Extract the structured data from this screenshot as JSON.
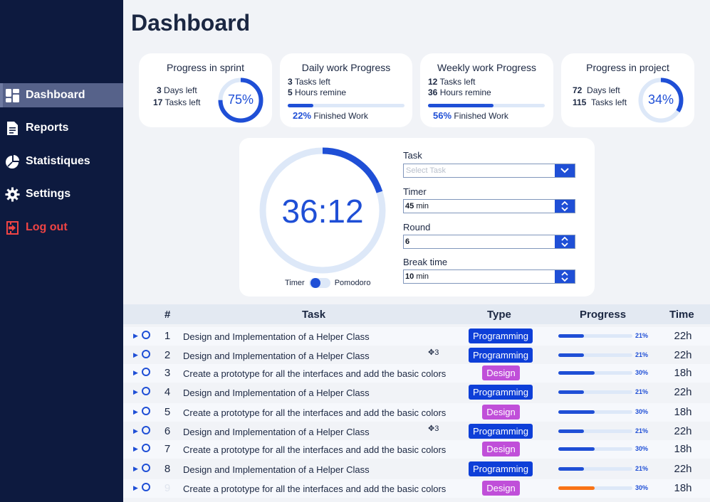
{
  "sidebar": {
    "items": [
      {
        "label": "Dashboard",
        "icon": "dashboard-icon",
        "active": true
      },
      {
        "label": "Reports",
        "icon": "document-icon"
      },
      {
        "label": "Statistiques",
        "icon": "pie-chart-icon"
      },
      {
        "label": "Settings",
        "icon": "gear-icon"
      },
      {
        "label": "Log out",
        "icon": "logout-icon",
        "color": "#ef4444"
      }
    ]
  },
  "page_title": "Dashboard",
  "cards": {
    "sprint": {
      "title": "Progress in sprint",
      "days": "3",
      "days_label": "Days left",
      "tasks": "17",
      "tasks_label": "Tasks left",
      "percent_label": "75%",
      "percent": 75
    },
    "daily": {
      "title": "Daily work Progress",
      "tasks": "3",
      "tasks_label": "Tasks left",
      "hours": "5",
      "hours_label": "Hours remine",
      "percent_label": "22%",
      "percent": 22,
      "finished_label": "Finished Work"
    },
    "weekly": {
      "title": "Weekly work Progress",
      "tasks": "12",
      "tasks_label": "Tasks left",
      "hours": "36",
      "hours_label": "Hours remine",
      "percent_label": "56%",
      "percent": 56,
      "finished_label": "Finished Work"
    },
    "project": {
      "title": "Progress in project",
      "days": "72",
      "days_label": "Days left",
      "tasks": "115",
      "tasks_label": "Tasks left",
      "percent_label": "34%",
      "percent": 34
    }
  },
  "timer": {
    "display": "36:12",
    "progress_fraction": 0.2,
    "toggle_left": "Timer",
    "toggle_right": "Pomodoro",
    "task_label": "Task",
    "task_placeholder": "Select Task",
    "timer_label": "Timer",
    "timer_value": "45",
    "timer_unit": "min",
    "round_label": "Round",
    "round_value": "6",
    "break_label": "Break time",
    "break_value": "10",
    "break_unit": "min"
  },
  "colors": {
    "accent": "#1f4fd6",
    "programming": "#0e3fd8",
    "design": "#c04fd9",
    "warning": "#f97316",
    "sidebar": "#0d1a3f"
  },
  "table": {
    "headers": {
      "num": "#",
      "task": "Task",
      "type": "Type",
      "progress": "Progress",
      "time": "Time"
    },
    "rows": [
      {
        "num": "1",
        "task": "Design and Implementation of a Helper Class",
        "type": "Programming",
        "percent": 21,
        "percent_label": "21%",
        "time": "22h"
      },
      {
        "num": "2",
        "task": "Design and Implementation of a Helper Class",
        "extra": "✥3",
        "type": "Programming",
        "percent": 21,
        "percent_label": "21%",
        "time": "22h"
      },
      {
        "num": "3",
        "task": "Create a prototype for all the interfaces and add the basic colors",
        "type": "Design",
        "percent": 30,
        "percent_label": "30%",
        "time": "18h"
      },
      {
        "num": "4",
        "task": "Design and Implementation of a Helper Class",
        "type": "Programming",
        "percent": 21,
        "percent_label": "21%",
        "time": "22h"
      },
      {
        "num": "5",
        "task": "Create a prototype for all the interfaces and add the basic colors",
        "type": "Design",
        "percent": 30,
        "percent_label": "30%",
        "time": "18h"
      },
      {
        "num": "6",
        "task": "Design and Implementation of a Helper Class",
        "extra": "✥3",
        "type": "Programming",
        "percent": 21,
        "percent_label": "21%",
        "time": "22h"
      },
      {
        "num": "7",
        "task": "Create a prototype for all the interfaces and add the basic colors",
        "type": "Design",
        "percent": 30,
        "percent_label": "30%",
        "time": "18h"
      },
      {
        "num": "8",
        "task": "Design and Implementation of a Helper Class",
        "type": "Programming",
        "percent": 21,
        "percent_label": "21%",
        "time": "22h"
      },
      {
        "num": "9",
        "task": "Create a prototype for all the interfaces and add the basic colors",
        "type": "Design",
        "percent": 30,
        "percent_label": "30%",
        "time": "18h",
        "bar_color": "#f97316"
      }
    ]
  }
}
